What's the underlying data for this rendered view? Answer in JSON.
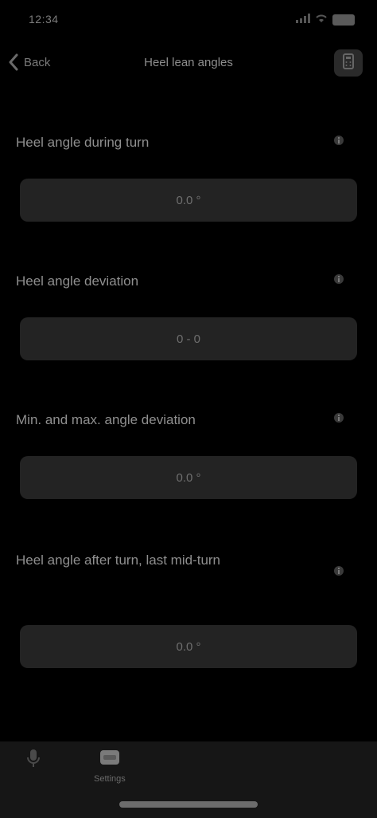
{
  "status_bar": {
    "time": "12:34"
  },
  "header": {
    "back_label": "Back",
    "title": "Heel lean angles"
  },
  "sections": [
    {
      "label": "Heel angle during turn",
      "value": "0.0 °"
    },
    {
      "label": "Heel angle deviation",
      "value": "0 - 0"
    },
    {
      "label": "Min. and max. angle deviation",
      "value": "0.0 °"
    },
    {
      "label": "Heel angle after turn, last mid-turn",
      "value": "0.0 °"
    }
  ],
  "tab_bar": {
    "tabs": [
      {
        "label": "",
        "icon": "mic-icon"
      },
      {
        "label": "Settings",
        "icon": "settings-tab-icon"
      }
    ]
  },
  "colors": {
    "background": "#000000",
    "card": "#232323",
    "tab_bar": "#161616",
    "text": "#8f8f8f"
  }
}
